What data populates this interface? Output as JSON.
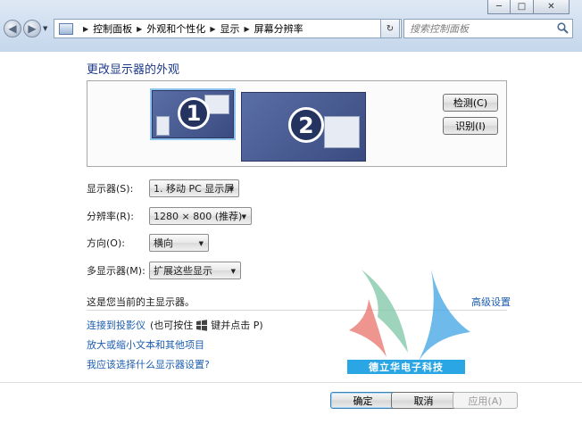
{
  "window": {
    "minimize_glyph": "─",
    "maximize_glyph": "□",
    "close_glyph": "✕"
  },
  "address_bar": {
    "breadcrumbs": [
      "控制面板",
      "外观和个性化",
      "显示",
      "屏幕分辨率"
    ]
  },
  "search": {
    "placeholder": "搜索控制面板"
  },
  "page": {
    "title": "更改显示器的外观",
    "monitors": {
      "monitor_1": "1",
      "monitor_2": "2"
    },
    "detect_button": "检测(C)",
    "identify_button": "识别(I)"
  },
  "form": {
    "display": {
      "label": "显示器(S):",
      "value": "1. 移动 PC 显示屏"
    },
    "resolution": {
      "label": "分辨率(R):",
      "value": "1280 × 800 (推荐)"
    },
    "orientation": {
      "label": "方向(O):",
      "value": "横向"
    },
    "multiple_displays": {
      "label": "多显示器(M):",
      "value": "扩展这些显示"
    }
  },
  "primary_note": "这是您当前的主显示器。",
  "advanced_link": "高级设置",
  "links": {
    "projector": "连接到投影仪",
    "projector_hint_pre": "(也可按住",
    "projector_hint_post": "键并点击 P)",
    "text_size": "放大或缩小文本和其他项目",
    "which_settings": "我应该选择什么显示器设置?"
  },
  "buttons": {
    "ok": "确定",
    "cancel": "取消",
    "apply": "应用(A)"
  },
  "watermark": {
    "text": "德立华电子科技",
    "colors": [
      "#e8716b",
      "#7cc6a4",
      "#4aa9e6"
    ]
  },
  "colors": {
    "title": "#1c3a8a",
    "link": "#1e5eb0",
    "monitor": "#4a5c93"
  },
  "icons": [
    "back-arrow-icon",
    "forward-arrow-icon",
    "control-panel-icon",
    "refresh-icon",
    "search-icon",
    "windows-key-icon"
  ]
}
